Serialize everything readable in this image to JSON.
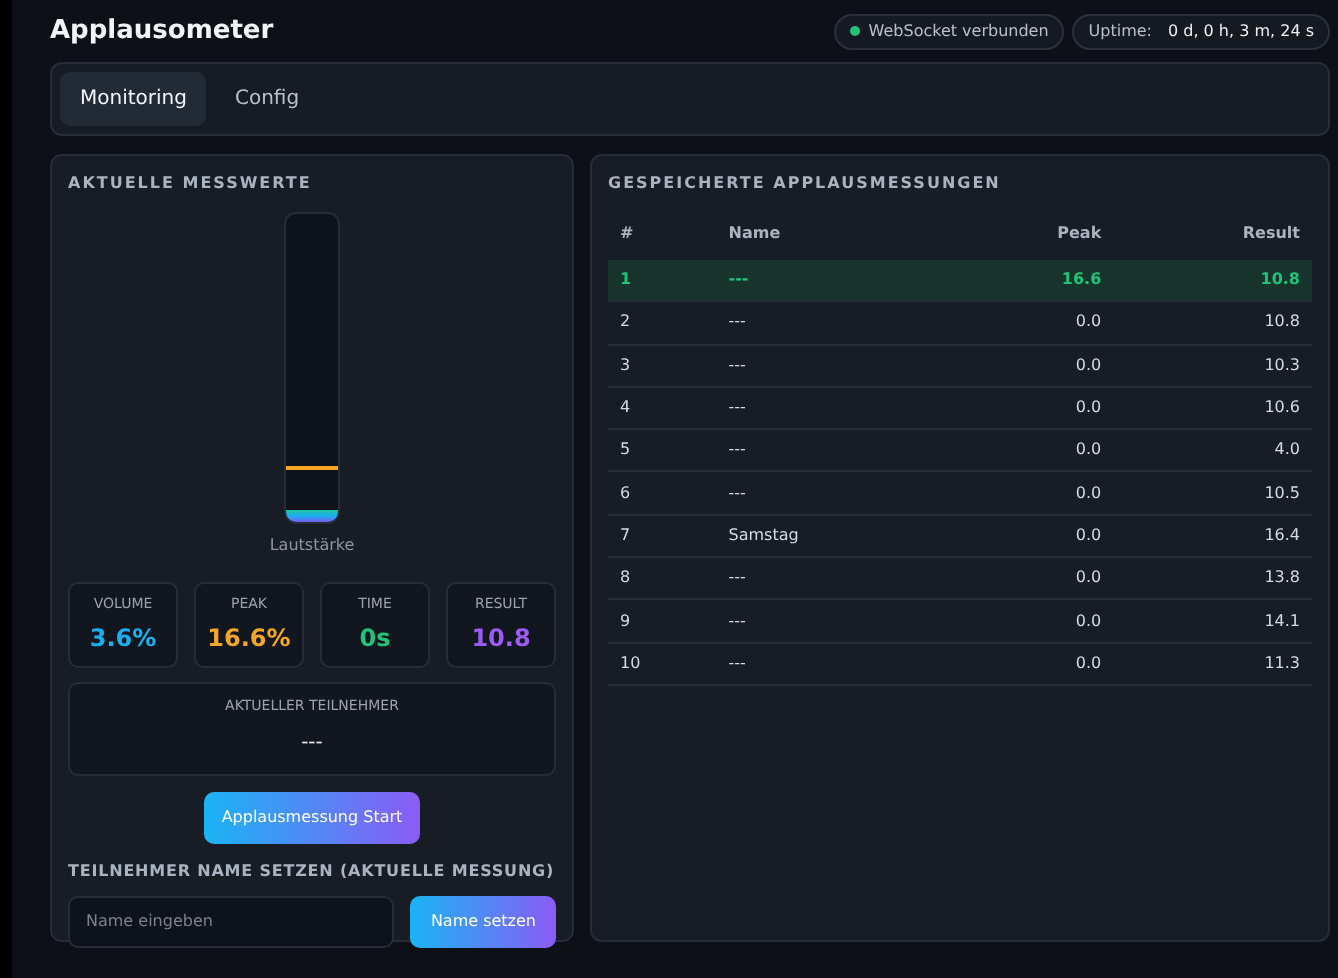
{
  "title": "Applausometer",
  "status": {
    "connection": "WebSocket verbunden",
    "connected": true,
    "uptime_label": "Uptime:",
    "uptime": "0 d, 0 h, 3 m, 24 s"
  },
  "tabs": [
    {
      "label": "Monitoring",
      "selected": true
    },
    {
      "label": "Config",
      "selected": false
    }
  ],
  "current": {
    "heading": "AKTUELLE MESSWERTE",
    "meter": {
      "level": 0.036,
      "peak_marker": {
        "level": 0.166
      },
      "label": "Lautstärke"
    },
    "stats": [
      {
        "label": "VOLUME",
        "value": "3.6%",
        "color": "#1ab0f0"
      },
      {
        "label": "PEAK",
        "value": "16.6%",
        "color": "#f5a623"
      },
      {
        "label": "TIME",
        "value": "0s",
        "color": "#1fc47a"
      },
      {
        "label": "RESULT",
        "value": "10.8",
        "color": "#9a5cf5"
      }
    ],
    "participant": {
      "label": "AKTUELLER TEILNEHMER",
      "value": "---"
    },
    "start_button": "Applausmessung Start",
    "name_heading": "TEILNEHMER NAME SETZEN (AKTUELLE MESSUNG)",
    "name_field": {
      "placeholder": "Name eingeben"
    },
    "name_button": "Name setzen"
  },
  "saved": {
    "heading": "GESPEICHERTE APPLAUSMESSUNGEN",
    "columns": [
      "#",
      "Name",
      "Peak",
      "Result"
    ],
    "rows": [
      {
        "cells": [
          "1",
          "---",
          "16.6",
          "10.8"
        ],
        "highlighted": true
      },
      {
        "cells": [
          "2",
          "---",
          "0.0",
          "10.8"
        ],
        "highlighted": false
      },
      {
        "cells": [
          "3",
          "---",
          "0.0",
          "10.3"
        ],
        "highlighted": false
      },
      {
        "cells": [
          "4",
          "---",
          "0.0",
          "10.6"
        ],
        "highlighted": false
      },
      {
        "cells": [
          "5",
          "---",
          "0.0",
          "4.0"
        ],
        "highlighted": false
      },
      {
        "cells": [
          "6",
          "---",
          "0.0",
          "10.5"
        ],
        "highlighted": false
      },
      {
        "cells": [
          "7",
          "Samstag",
          "0.0",
          "16.4"
        ],
        "highlighted": false
      },
      {
        "cells": [
          "8",
          "---",
          "0.0",
          "13.8"
        ],
        "highlighted": false
      },
      {
        "cells": [
          "9",
          "---",
          "0.0",
          "14.1"
        ],
        "highlighted": false
      },
      {
        "cells": [
          "10",
          "---",
          "0.0",
          "11.3"
        ],
        "highlighted": false
      }
    ]
  }
}
